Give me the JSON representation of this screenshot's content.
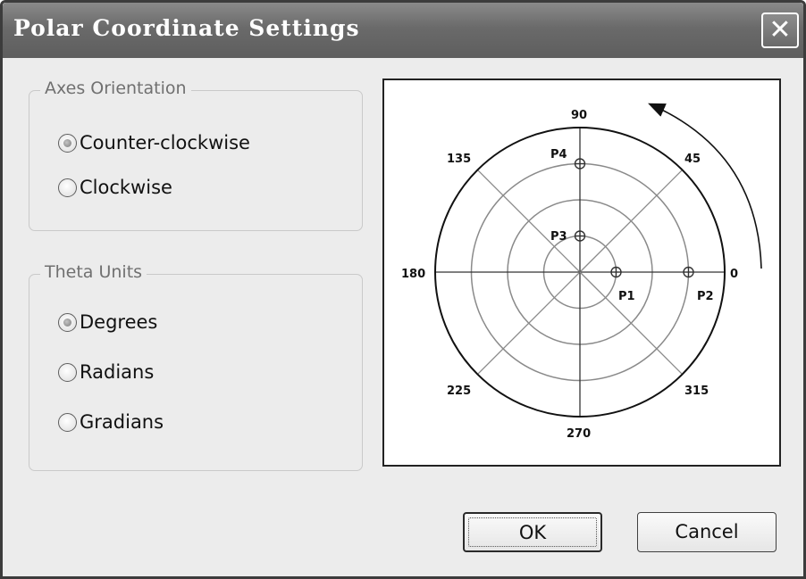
{
  "window": {
    "title": "Polar Coordinate Settings",
    "close_icon": "close-icon"
  },
  "axes_orientation": {
    "legend": "Axes Orientation",
    "options": [
      {
        "label": "Counter-clockwise",
        "checked": true
      },
      {
        "label": "Clockwise",
        "checked": false
      }
    ]
  },
  "theta_units": {
    "legend": "Theta Units",
    "options": [
      {
        "label": "Degrees",
        "checked": true
      },
      {
        "label": "Radians",
        "checked": false
      },
      {
        "label": "Gradians",
        "checked": false
      }
    ]
  },
  "preview": {
    "angle_labels": {
      "a0": "0",
      "a45": "45",
      "a90": "90",
      "a135": "135",
      "a180": "180",
      "a225": "225",
      "a270": "270",
      "a315": "315"
    },
    "points": [
      {
        "label": "P1",
        "r": 1,
        "theta_deg": 0
      },
      {
        "label": "P2",
        "r": 3,
        "theta_deg": 0
      },
      {
        "label": "P3",
        "r": 1,
        "theta_deg": 90
      },
      {
        "label": "P4",
        "r": 3,
        "theta_deg": 90
      }
    ],
    "ring_count": 4,
    "direction_arrow": "counter-clockwise"
  },
  "buttons": {
    "ok": "OK",
    "cancel": "Cancel"
  }
}
